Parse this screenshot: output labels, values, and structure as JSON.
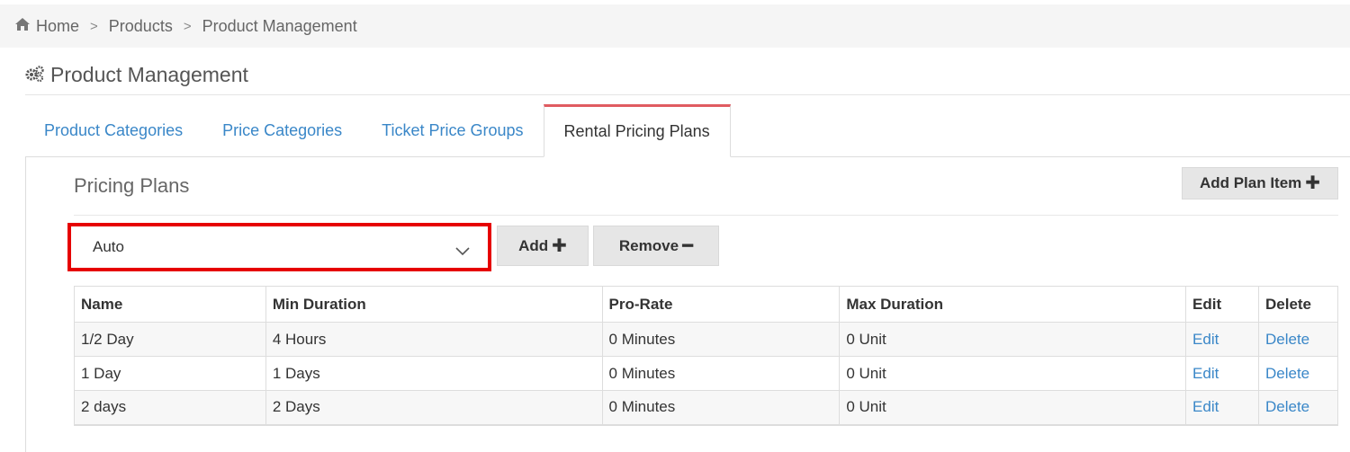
{
  "breadcrumb": {
    "home_icon": "home-icon",
    "items": [
      "Home",
      "Products",
      "Product Management"
    ]
  },
  "page": {
    "title": "Product Management",
    "title_icon": "gears-icon"
  },
  "tabs": [
    {
      "label": "Product Categories",
      "active": false
    },
    {
      "label": "Price Categories",
      "active": false
    },
    {
      "label": "Ticket Price Groups",
      "active": false
    },
    {
      "label": "Rental Pricing Plans",
      "active": true
    }
  ],
  "section": {
    "title": "Pricing Plans",
    "add_plan_item_label": "Add Plan Item"
  },
  "plan_select": {
    "value": "Auto",
    "highlight_color": "#e60000"
  },
  "toolbar": {
    "add_label": "Add",
    "remove_label": "Remove"
  },
  "table": {
    "columns": [
      "Name",
      "Min Duration",
      "Pro-Rate",
      "Max Duration",
      "Edit",
      "Delete"
    ],
    "rows": [
      {
        "name": "1/2 Day",
        "min": "4 Hours",
        "prorate": "0 Minutes",
        "max": "0 Unit",
        "edit": "Edit",
        "delete": "Delete"
      },
      {
        "name": "1 Day",
        "min": "1 Days",
        "prorate": "0 Minutes",
        "max": "0 Unit",
        "edit": "Edit",
        "delete": "Delete"
      },
      {
        "name": "2 days",
        "min": "2 Days",
        "prorate": "0 Minutes",
        "max": "0 Unit",
        "edit": "Edit",
        "delete": "Delete"
      }
    ]
  },
  "colors": {
    "link": "#3a87c8",
    "active_tab_accent": "#e05b61"
  }
}
